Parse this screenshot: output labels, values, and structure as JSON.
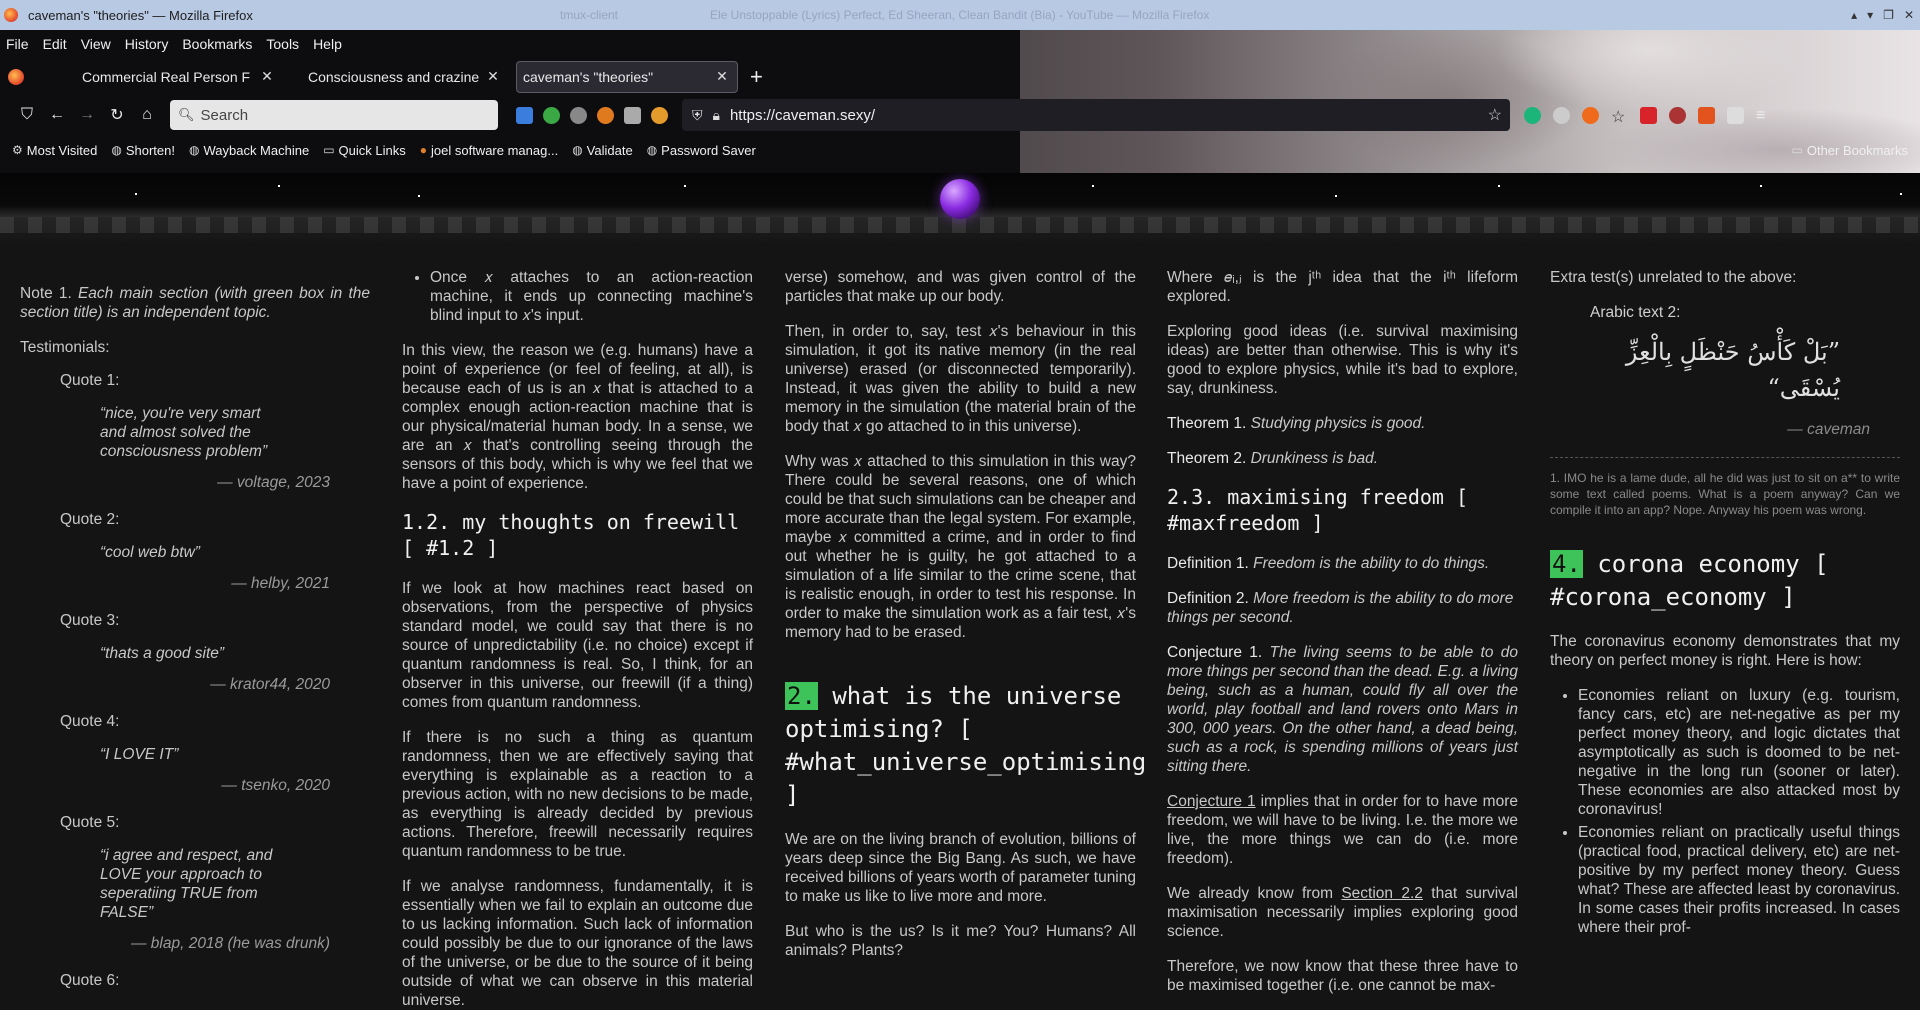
{
  "window": {
    "title": "caveman's \"theories\" — Mozilla Firefox",
    "ghost_title_1": "tmux-client",
    "ghost_title_2": "Ele Unstoppable (Lyrics) Perfect, Ed Sheeran, Clean Bandit (Bia) - YouTube — Mozilla Firefox"
  },
  "menu": [
    "File",
    "Edit",
    "View",
    "History",
    "Bookmarks",
    "Tools",
    "Help"
  ],
  "tabs": [
    {
      "label": "Commercial Real Person F"
    },
    {
      "label": "Consciousness and crazine"
    },
    {
      "label": "caveman's \"theories\""
    }
  ],
  "navbar": {
    "search_placeholder": "Search",
    "url": "https://caveman.sexy/"
  },
  "bookmarks": [
    "Most Visited",
    "Shorten!",
    "Wayback Machine",
    "Quick Links",
    "joel software manag...",
    "Validate",
    "Password Saver",
    "Other Bookmarks"
  ],
  "col1": {
    "note_label": "Note 1.",
    "note_text": "Each main section (with green box in the section title) is an independent topic.",
    "testimonials_label": "Testimonials:",
    "quotes": [
      {
        "head": "Quote 1:",
        "text": "“nice, you're very smart and almost solved the consciousness problem”",
        "author": "— voltage, 2023"
      },
      {
        "head": "Quote 2:",
        "text": "“cool web btw”",
        "author": "— helby, 2021"
      },
      {
        "head": "Quote 3:",
        "text": "“thats a good site”",
        "author": "— krator44, 2020"
      },
      {
        "head": "Quote 4:",
        "text": "“I LOVE IT”",
        "author": "— tsenko, 2020"
      },
      {
        "head": "Quote 5:",
        "text": "“i agree and respect, and LOVE your approach to seperatiing TRUE from FALSE”",
        "author": "— blap, 2018 (he was drunk)"
      }
    ],
    "quote6_head": "Quote 6:"
  },
  "col2": {
    "bullet": "Once 𝑥 attaches to an action-reaction machine, it ends up connecting machine's blind input to 𝑥's input.",
    "p1": "In this view, the reason we (e.g. humans) have a point of experience (or feel of feeling, at all), is because each of us is an 𝑥 that is attached to a complex enough action-reaction machine that is our physical/material human body. In a sense, we are an 𝑥 that's controlling seeing through the sensors of this body, which is why we feel that we have a point of experience.",
    "h_freewill": "1.2. my thoughts on freewill [ #1.2 ]",
    "p2": "If we look at how machines react based on observations, from the perspective of physics standard model, we could say that there is no source of unpredictability (i.e. no choice) except if quantum randomness is real. So, I think, for an observer in this universe, our freewill (if a thing) comes from quantum randomness.",
    "p3": "If there is no such a thing as quantum randomness, then we are effectively saying that everything is explainable as a reaction to a previous action, with no new decisions to be made, as everything is already decided by previous actions. Therefore, freewill necessarily requires quantum randomness to be true.",
    "p4": "If we analyse randomness, fundamentally, it is essentially when we fail to explain an outcome due to us lacking information. Such lack of information could possibly be due to our ignorance of the laws of the universe, or be due to the source of it being outside of what we can observe in this material universe."
  },
  "col3": {
    "p1": "verse) somehow, and was given control of the particles that make up our body.",
    "p2": "Then, in order to, say, test 𝑥's behaviour in this simulation, it got its native memory (in the real universe) erased (or disconnected temporarily). Instead, it was given the ability to build a new memory in the simulation (the material brain of the body that 𝑥 go attached to in this universe).",
    "p3": "Why was 𝑥 attached to this simulation in this way? There could be several reasons, one of which could be that such simulations can be cheaper and more accurate than the legal system. For example, maybe 𝑥 committed a crime, and in order to find out whether he is guilty, he got attached to a simulation of a life similar to the crime scene, that is realistic enough, in order to test his response. In order to make the simulation work as a fair test, 𝑥's memory had to be erased.",
    "h2_num": "2.",
    "h2_text": " what is the universe optimising? [ #what_universe_optimising ]",
    "p4": "We are on the living branch of evolution, billions of years deep since the Big Bang. As such, we have received billions of years worth of parameter tuning to make us like to live more and more.",
    "p5": "But who is the us? Is it me? You? Humans? All animals? Plants?"
  },
  "col4": {
    "p1": "Where 𝑒ᵢ,ⱼ is the jᵗʰ idea that the iᵗʰ lifeform explored.",
    "p2": "Exploring good ideas (i.e. survival maximising ideas) are better than otherwise. This is why it's good to explore physics, while it's bad to explore, say, drunkiness.",
    "t1_label": "Theorem 1.",
    "t1_text": "Studying physics is good.",
    "t2_label": "Theorem 2.",
    "t2_text": "Drunkiness is bad.",
    "h_freedom": "2.3. maximising freedom [ #maxfreedom ]",
    "d1_label": "Definition 1.",
    "d1_text": "Freedom is the ability to do things.",
    "d2_label": "Definition 2.",
    "d2_text": "More freedom is the ability to do more things per second.",
    "c1_label": "Conjecture 1.",
    "c1_text": "The living seems to be able to do more things per second than the dead. E.g. a living being, such as a human, could fly all over the world, play football and land rovers onto Mars in 300, 000 years. On the other hand, a dead being, such as a rock, is spending millions of years just sitting there.",
    "p3_link": "Conjecture 1",
    "p3_rest": " implies that in order for to have more freedom, we will have to be living. I.e. the more we live, the more things we can do (i.e. more freedom).",
    "p4_pre": "We already know from ",
    "p4_link": "Section 2.2",
    "p4_rest": " that survival maximisation necessarily implies exploring good science.",
    "p5": "Therefore, we now know that these three have to be maximised together (i.e. one cannot be max-"
  },
  "col5": {
    "extra": "Extra test(s) unrelated to the above:",
    "arabic_label": "Arabic text 2:",
    "arabic": "”بَلْ كَأْسُ حَنْظَلٍ بِالْعِزِّ يُسْقَى“",
    "arabic_author": "— caveman",
    "footnote": "1. IMO he is a lame dude, all he did was just to sit on a** to write some text called poems. What is a poem anyway? Can we compile it into an app? Nope. Anyway his poem was wrong.",
    "h4_num": "4.",
    "h4_text": " corona economy [ #corona_economy ]",
    "p1": "The coronavirus economy demonstrates that my theory on perfect money is right. Here is how:",
    "b1": "Economies reliant on luxury (e.g. tourism, fancy cars, etc) are net-negative as per my perfect money theory, and logic dictates that asymptotically as such is doomed to be net-negative in the long run (sooner or later). These economies are also attacked most by coronavirus!",
    "b2": "Economies reliant on practically useful things (practical food, practical delivery, etc) are net-positive by my perfect money theory. Guess what? These are affected least by coronavirus. In some cases their profits increased. In cases where their prof-"
  }
}
